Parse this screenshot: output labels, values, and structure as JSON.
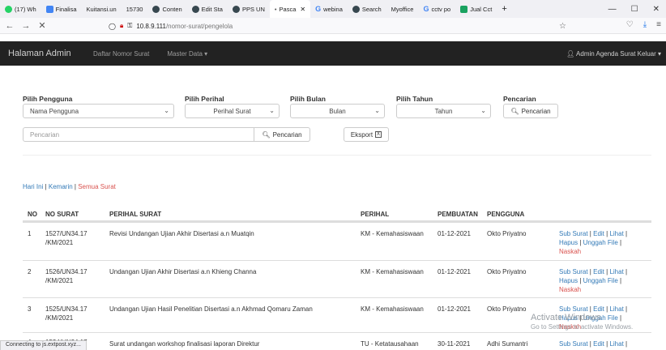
{
  "browser": {
    "tabs": [
      {
        "label": "(17) Wh",
        "sub": "MUTED",
        "color": "#25d366"
      },
      {
        "label": "Finalisa",
        "color": "#4285f4"
      },
      {
        "label": "Kuitansi.un",
        "color": ""
      },
      {
        "label": "15730",
        "color": ""
      },
      {
        "label": "Conten",
        "color": "#37474f"
      },
      {
        "label": "Edit Sta",
        "color": "#37474f"
      },
      {
        "label": "PPS UN",
        "color": "#37474f"
      },
      {
        "label": "Pasca",
        "color": "#37474f",
        "active": true
      },
      {
        "label": "webina",
        "color": "g"
      },
      {
        "label": "Search",
        "color": "#37474f"
      },
      {
        "label": "Myoffice",
        "color": ""
      },
      {
        "label": "cctv po",
        "color": "g"
      },
      {
        "label": "Jual Cct",
        "color": "#1aa260"
      }
    ],
    "new_tab": "+",
    "window_controls": [
      "—",
      "☐",
      "✕"
    ],
    "url_domain": "10.8.9.111",
    "url_path": "/nomor-surat/pengelola",
    "status_text": "Connecting to js.extpost.xyz..."
  },
  "app": {
    "brand": "Halaman Admin",
    "nav": [
      "Daftar Nomor Surat",
      "Master Data ▾"
    ],
    "user": "Admin Agenda Surat Keluar ▾"
  },
  "filters": {
    "pengguna_label": "Pilih Pengguna",
    "pengguna_value": "Nama Pengguna",
    "perihal_label": "Pilih Perihal",
    "perihal_value": "Perihal Surat",
    "bulan_label": "Pilih Bulan",
    "bulan_value": "Bulan",
    "tahun_label": "Pilih Tahun",
    "tahun_value": "Tahun",
    "pencarian_label": "Pencarian",
    "pencarian_button": "Pencarian",
    "search_placeholder": "Pencarian",
    "search_button": "Pencarian",
    "export_button": "Eksport"
  },
  "quick": {
    "today": "Hari Ini",
    "yesterday": "Kemarin",
    "all": "Semua Surat",
    "sep": " | "
  },
  "table": {
    "headers": [
      "NO",
      "NO SURAT",
      "PERIHAL SURAT",
      "PERIHAL",
      "PEMBUATAN",
      "PENGGUNA"
    ],
    "actions": {
      "sub": "Sub Surat",
      "edit": "Edit",
      "lihat": "Lihat",
      "hapus": "Hapus",
      "unggah": "Unggah File",
      "naskah": "Naskah",
      "sep": " | "
    },
    "rows": [
      {
        "no": "1",
        "no_surat_1": "1527/UN34.17",
        "no_surat_2": "/KM/2021",
        "perihal_surat": "Revisi Undangan Ujian Akhir Disertasi a.n Muatqin",
        "perihal": "KM - Kemahasiswaan",
        "pembuatan": "01-12-2021",
        "pengguna": "Okto Priyatno"
      },
      {
        "no": "2",
        "no_surat_1": "1526/UN34.17",
        "no_surat_2": "/KM/2021",
        "perihal_surat": "Undangan Ujian Akhir Disertasi a.n Khieng Channa",
        "perihal": "KM - Kemahasiswaan",
        "pembuatan": "01-12-2021",
        "pengguna": "Okto Priyatno"
      },
      {
        "no": "3",
        "no_surat_1": "1525/UN34.17",
        "no_surat_2": "/KM/2021",
        "perihal_surat": "Undangan Ujian Hasil Penelitian Disertasi a.n Akhmad Qomaru Zaman",
        "perihal": "KM - Kemahasiswaan",
        "pembuatan": "01-12-2021",
        "pengguna": "Okto Priyatno"
      },
      {
        "no": "4",
        "no_surat_1": "1524/UN34.17",
        "no_surat_2": "",
        "perihal_surat": "Surat undangan workshop finalisasi laporan Direktur",
        "perihal": "TU - Ketatausahaan",
        "pembuatan": "30-11-2021",
        "pengguna": "Adhi Sumantri"
      }
    ]
  },
  "watermark": {
    "line1": "Activate Windows",
    "line2": "Go to Settings to activate Windows."
  }
}
